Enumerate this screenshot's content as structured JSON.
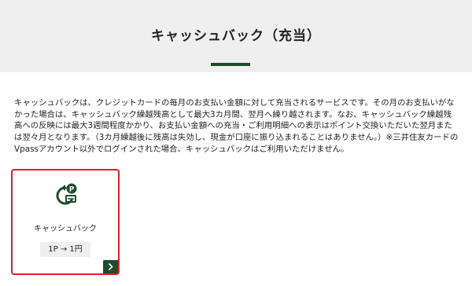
{
  "header": {
    "title": "キャッシュバック（充当）"
  },
  "description": "キャッシュバックは、クレジットカードの毎月のお支払い金額に対して充当されるサービスです。その月のお支払いがなかった場合は、キャッシュバック繰越残高として最大3カ月間、翌月へ繰り越されます。なお、キャッシュバック繰越残高への反映には最大3週間程度かかり、お支払い金額への充当・ご利用明細への表示はポイント交換いただいた翌月または翌々月となります。（3カ月繰越後に残高は失効し、現金が口座に振り込まれることはありません。）※三井住友カードのVpassアカウント以外でログインされた場合、キャッシュバックはご利用いただけません。",
  "card": {
    "label": "キャッシュバック",
    "rate": "1P → 1円",
    "icon": "cashback-coin-icon",
    "arrow_icon": "chevron-right-icon",
    "border_color": "#d9232a",
    "accent_color": "#1e4d2b"
  }
}
